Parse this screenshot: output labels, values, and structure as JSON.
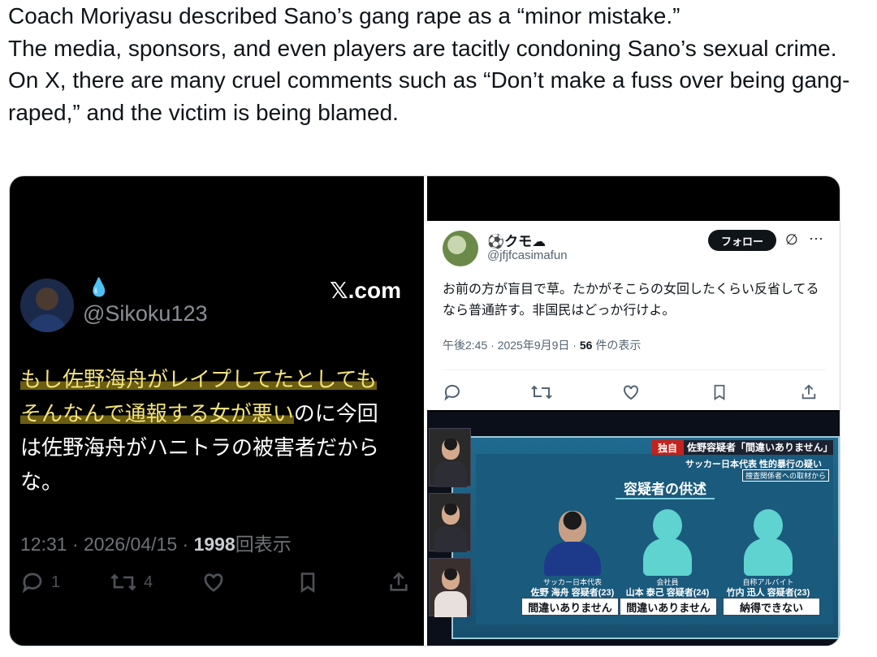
{
  "post": {
    "lines": [
      "Coach Moriyasu described Sano’s gang rape as a “minor mistake.”",
      "The media, sponsors, and even players are tacitly condoning Sano’s sexual crime.",
      "On X, there are many cruel comments such as “Don’t make a fuss over being gang-raped,” and the victim is being blamed."
    ]
  },
  "left_tweet": {
    "name_emoji": "💧",
    "handle": "@Sikoku123",
    "brand": "𝕏.com",
    "body_highlight_1": "もし佐野海舟がレイプしてたとしても",
    "body_highlight_2": "そんなんで通報する女が悪い",
    "body_rest_1": "のに今回",
    "body_rest_2": "は佐野海舟がハニトラの被害者だから",
    "body_rest_3": "な。",
    "time": "12:31 · 2026/04/15 · ",
    "views": "1998",
    "views_label": "回表示",
    "reply_count": "1",
    "retweet_count": "4"
  },
  "right_tweet": {
    "name": "⚽クモ☁",
    "handle": "@jfjfcasimafun",
    "follow_label": "フォロー",
    "grok_glyph": "∅",
    "more_glyph": "···",
    "body": "お前の方が盲目で草。たかがそこらの女回したくらい反省してるなら普通許す。非国民はどっか行けよ。",
    "time": "午後2:45 · 2025年9月9日 · ",
    "views": "56",
    "views_label": " 件の表示"
  },
  "tv": {
    "tag": "独自",
    "headline": "佐野容疑者「間違いありません」",
    "sub": "サッカー日本代表 性的暴行の疑い",
    "note": "捜査関係者への取材から",
    "title": "容疑者の供述",
    "people": [
      {
        "role": "サッカー日本代表",
        "name": "佐野 海舟 容疑者(23)",
        "statement": "間違いありません"
      },
      {
        "role": "会社員",
        "name": "山本 泰己 容疑者(24)",
        "statement": "間違いありません"
      },
      {
        "role": "自称アルバイト",
        "name": "竹内 迅人 容疑者(23)",
        "statement": "納得できない"
      }
    ]
  },
  "colors": {
    "highlight": "#f3e37a",
    "dark_bg": "#000000",
    "tv_panel": "#1f6a8f",
    "accent_red": "#c8201a"
  }
}
